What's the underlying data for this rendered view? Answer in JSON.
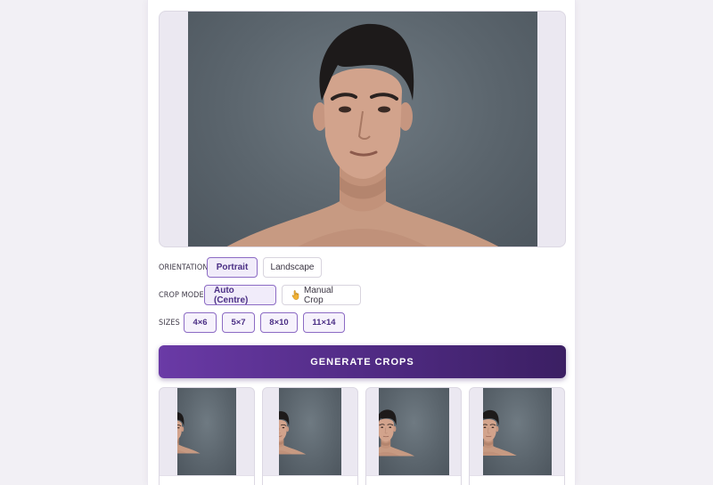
{
  "controls": {
    "orientation": {
      "label": "ORIENTATION",
      "options": [
        "Portrait",
        "Landscape"
      ],
      "selected": "Portrait"
    },
    "crop_mode": {
      "label": "CROP MODE",
      "options": [
        "Auto (Centre)",
        "Manual Crop"
      ],
      "selected": "Auto (Centre)",
      "manual_icon": "hand-pointer-icon"
    },
    "sizes": {
      "label": "SIZES",
      "options": [
        "4×6",
        "5×7",
        "8×10",
        "11×14"
      ]
    }
  },
  "generate_button": {
    "label": "GENERATE CROPS"
  },
  "colors": {
    "accent": "#5b2f94",
    "accent_light": "#f1ecfa",
    "background": "#f2f0f5"
  }
}
